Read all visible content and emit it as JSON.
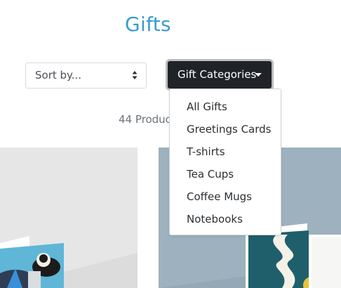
{
  "page": {
    "title": "Gifts",
    "product_count": "44 Product"
  },
  "sort": {
    "selected": "Sort by..."
  },
  "categories_button": {
    "label": "Gift Categories"
  },
  "dropdown": {
    "items": [
      {
        "label": "All Gifts"
      },
      {
        "label": "Greetings Cards"
      },
      {
        "label": "T-shirts"
      },
      {
        "label": "Tea Cups"
      },
      {
        "label": "Coffee Mugs"
      },
      {
        "label": "Notebooks"
      }
    ]
  },
  "colors": {
    "title": "#3a9bd1",
    "button_bg": "#1f2327",
    "card_left_bg": "#e4e4e4",
    "card_right_bg": "#9eb1bf"
  }
}
